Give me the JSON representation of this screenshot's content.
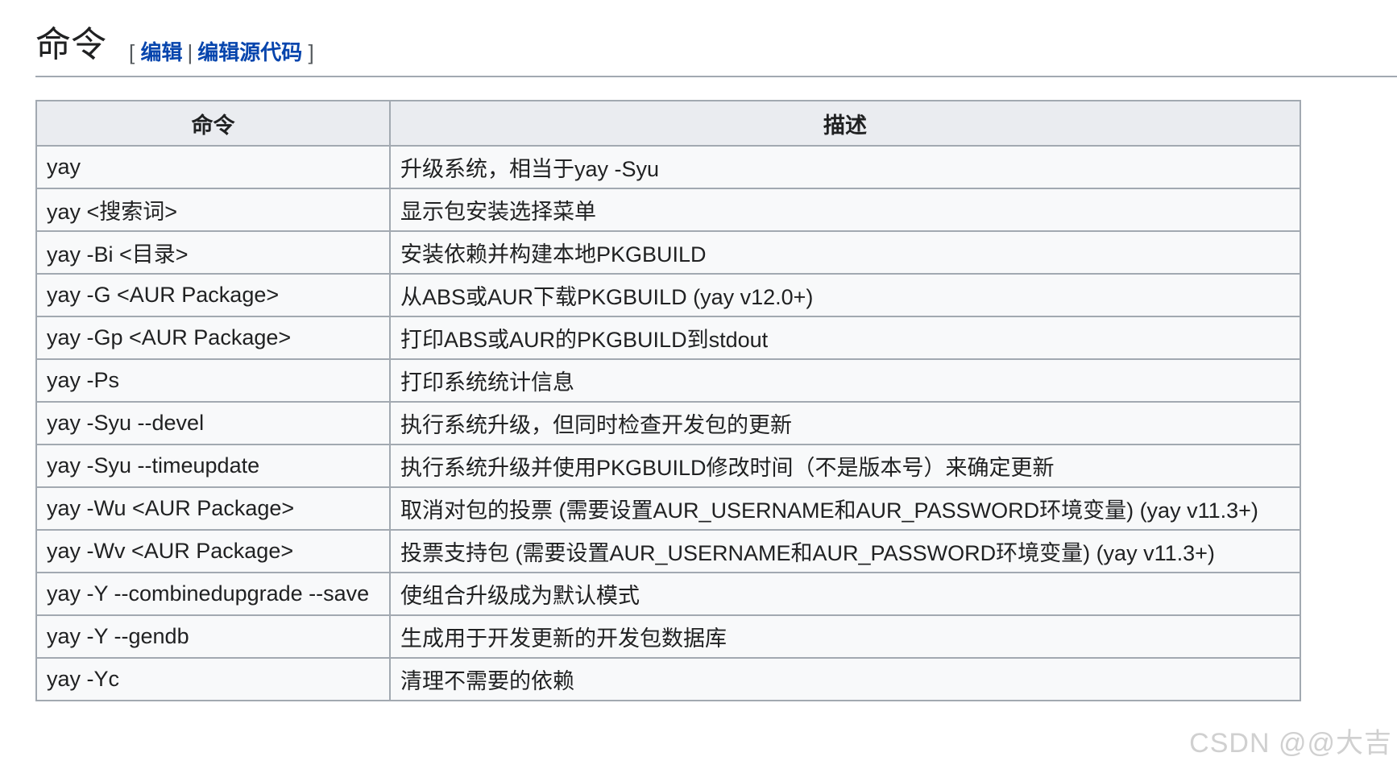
{
  "section": {
    "title": "命令",
    "edit_open": "[",
    "edit_label": "编辑",
    "separator": "|",
    "edit_source_label": "编辑源代码",
    "edit_close": "]"
  },
  "table": {
    "headers": [
      "命令",
      "描述"
    ],
    "rows": [
      {
        "command": "yay",
        "description": "升级系统，相当于yay -Syu"
      },
      {
        "command": "yay <搜索词>",
        "description": "显示包安装选择菜单"
      },
      {
        "command": "yay -Bi <目录>",
        "description": "安装依赖并构建本地PKGBUILD"
      },
      {
        "command": "yay -G <AUR Package>",
        "description": "从ABS或AUR下载PKGBUILD (yay v12.0+)"
      },
      {
        "command": "yay -Gp <AUR Package>",
        "description": "打印ABS或AUR的PKGBUILD到stdout"
      },
      {
        "command": "yay -Ps",
        "description": "打印系统统计信息"
      },
      {
        "command": "yay -Syu --devel",
        "description": "执行系统升级，但同时检查开发包的更新"
      },
      {
        "command": "yay -Syu --timeupdate",
        "description": "执行系统升级并使用PKGBUILD修改时间（不是版本号）来确定更新"
      },
      {
        "command": "yay -Wu <AUR Package>",
        "description": "取消对包的投票 (需要设置AUR_USERNAME和AUR_PASSWORD环境变量) (yay v11.3+)"
      },
      {
        "command": "yay -Wv <AUR Package>",
        "description": "投票支持包 (需要设置AUR_USERNAME和AUR_PASSWORD环境变量) (yay v11.3+)"
      },
      {
        "command": "yay -Y --combinedupgrade --save",
        "description": "使组合升级成为默认模式"
      },
      {
        "command": "yay -Y --gendb",
        "description": "生成用于开发更新的开发包数据库"
      },
      {
        "command": "yay -Yc",
        "description": "清理不需要的依赖"
      }
    ]
  },
  "watermark": "CSDN @@大吉"
}
